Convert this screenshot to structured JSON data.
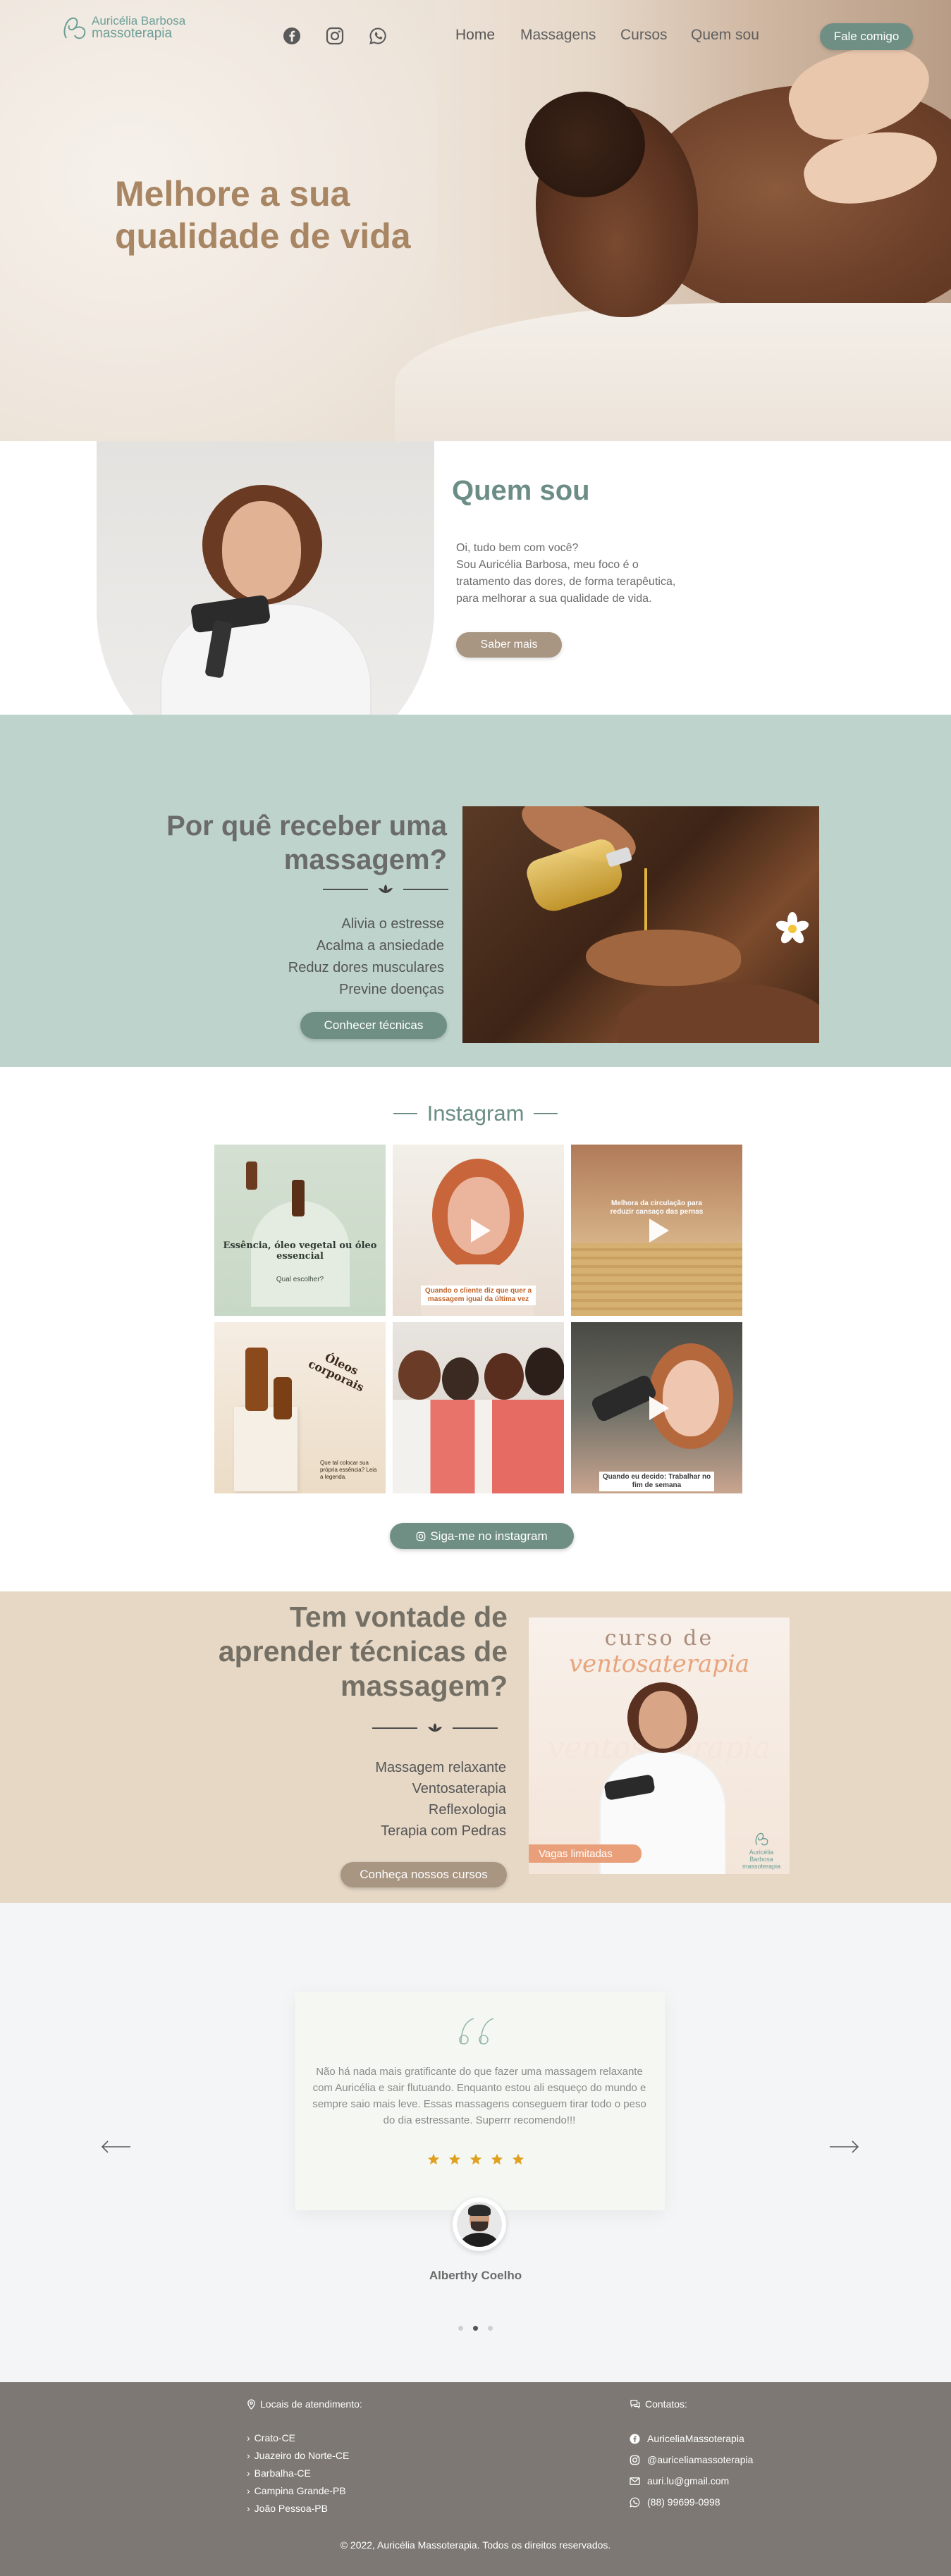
{
  "brand": {
    "name_line1": "Auricélia Barbosa",
    "name_line2": "massoterapia",
    "accent_color": "#6f8f85",
    "brown_color": "#a89582"
  },
  "nav": {
    "social_icons": [
      "facebook-icon",
      "instagram-icon",
      "whatsapp-icon"
    ],
    "items": [
      {
        "label": "Home"
      },
      {
        "label": "Massagens"
      },
      {
        "label": "Cursos"
      },
      {
        "label": "Quem sou"
      }
    ],
    "cta_label": "Fale comigo"
  },
  "hero": {
    "title": "Melhore a sua qualidade de vida"
  },
  "about": {
    "title": "Quem sou",
    "text_lines": [
      "Oi, tudo bem com você?",
      "Sou Auricélia Barbosa, meu foco é o",
      "tratamento das dores, de forma terapêutica,",
      "para melhorar a sua qualidade de vida."
    ],
    "button_label": "Saber mais"
  },
  "why": {
    "title": "Por quê receber uma massagem?",
    "items": [
      "Alivia o estresse",
      "Acalma a ansiedade",
      "Reduz dores musculares",
      "Previne doenças"
    ],
    "button_label": "Conhecer técnicas"
  },
  "instagram": {
    "title": "Instagram",
    "tiles": [
      {
        "caption": "Essência, óleo vegetal ou óleo essencial",
        "sub": "Qual escolher?",
        "video": false
      },
      {
        "caption": "Quando o cliente diz que quer a massagem igual da última vez",
        "sub": "",
        "video": true
      },
      {
        "caption": "Melhora da circulação para reduzir cansaço das pernas",
        "sub": "",
        "video": true
      },
      {
        "caption": "Óleos corporais",
        "sub": "Que tal colocar sua própria essência? Leia a legenda.",
        "video": false
      },
      {
        "caption": "",
        "sub": "",
        "video": false
      },
      {
        "caption": "Quando eu decido: Trabalhar no fim de semana",
        "sub": "",
        "video": true
      }
    ],
    "button_label": "Siga-me no instagram"
  },
  "courses": {
    "title": "Tem vontade de aprender técnicas de massagem?",
    "items": [
      "Massagem relaxante",
      "Ventosaterapia",
      "Reflexologia",
      "Terapia com Pedras"
    ],
    "button_label": "Conheça nossos cursos",
    "card": {
      "line1": "curso de",
      "line2": "ventosaterapia",
      "badge": "Vagas limitadas"
    }
  },
  "testimonial": {
    "text": "Não há nada mais gratificante do que fazer uma massagem relaxante com Auricélia e sair flutuando. Enquanto estou ali esqueço do mundo e sempre saio mais leve. Essas massagens conseguem tirar todo o peso do dia estressante. Superrr recomendo!!!",
    "stars": 5,
    "name": "Alberthy Coelho",
    "slide_count": 3,
    "active_slide": 2,
    "star_color": "#e0a020"
  },
  "footer": {
    "locations_title": "Locais de atendimento:",
    "locations": [
      "Crato-CE",
      "Juazeiro do Norte-CE",
      "Barbalha-CE",
      "Campina Grande-PB",
      "João Pessoa-PB"
    ],
    "contacts_title": "Contatos:",
    "contacts": [
      {
        "icon": "facebook-icon",
        "text": "AuriceliaMassoterapia"
      },
      {
        "icon": "instagram-icon",
        "text": "@auriceliamassoterapia"
      },
      {
        "icon": "mail-icon",
        "text": "auri.lu@gmail.com"
      },
      {
        "icon": "whatsapp-icon",
        "text": "(88) 99699-0998"
      }
    ],
    "copyright": "© 2022, Auricélia Massoterapia. Todos os direitos reservados."
  }
}
